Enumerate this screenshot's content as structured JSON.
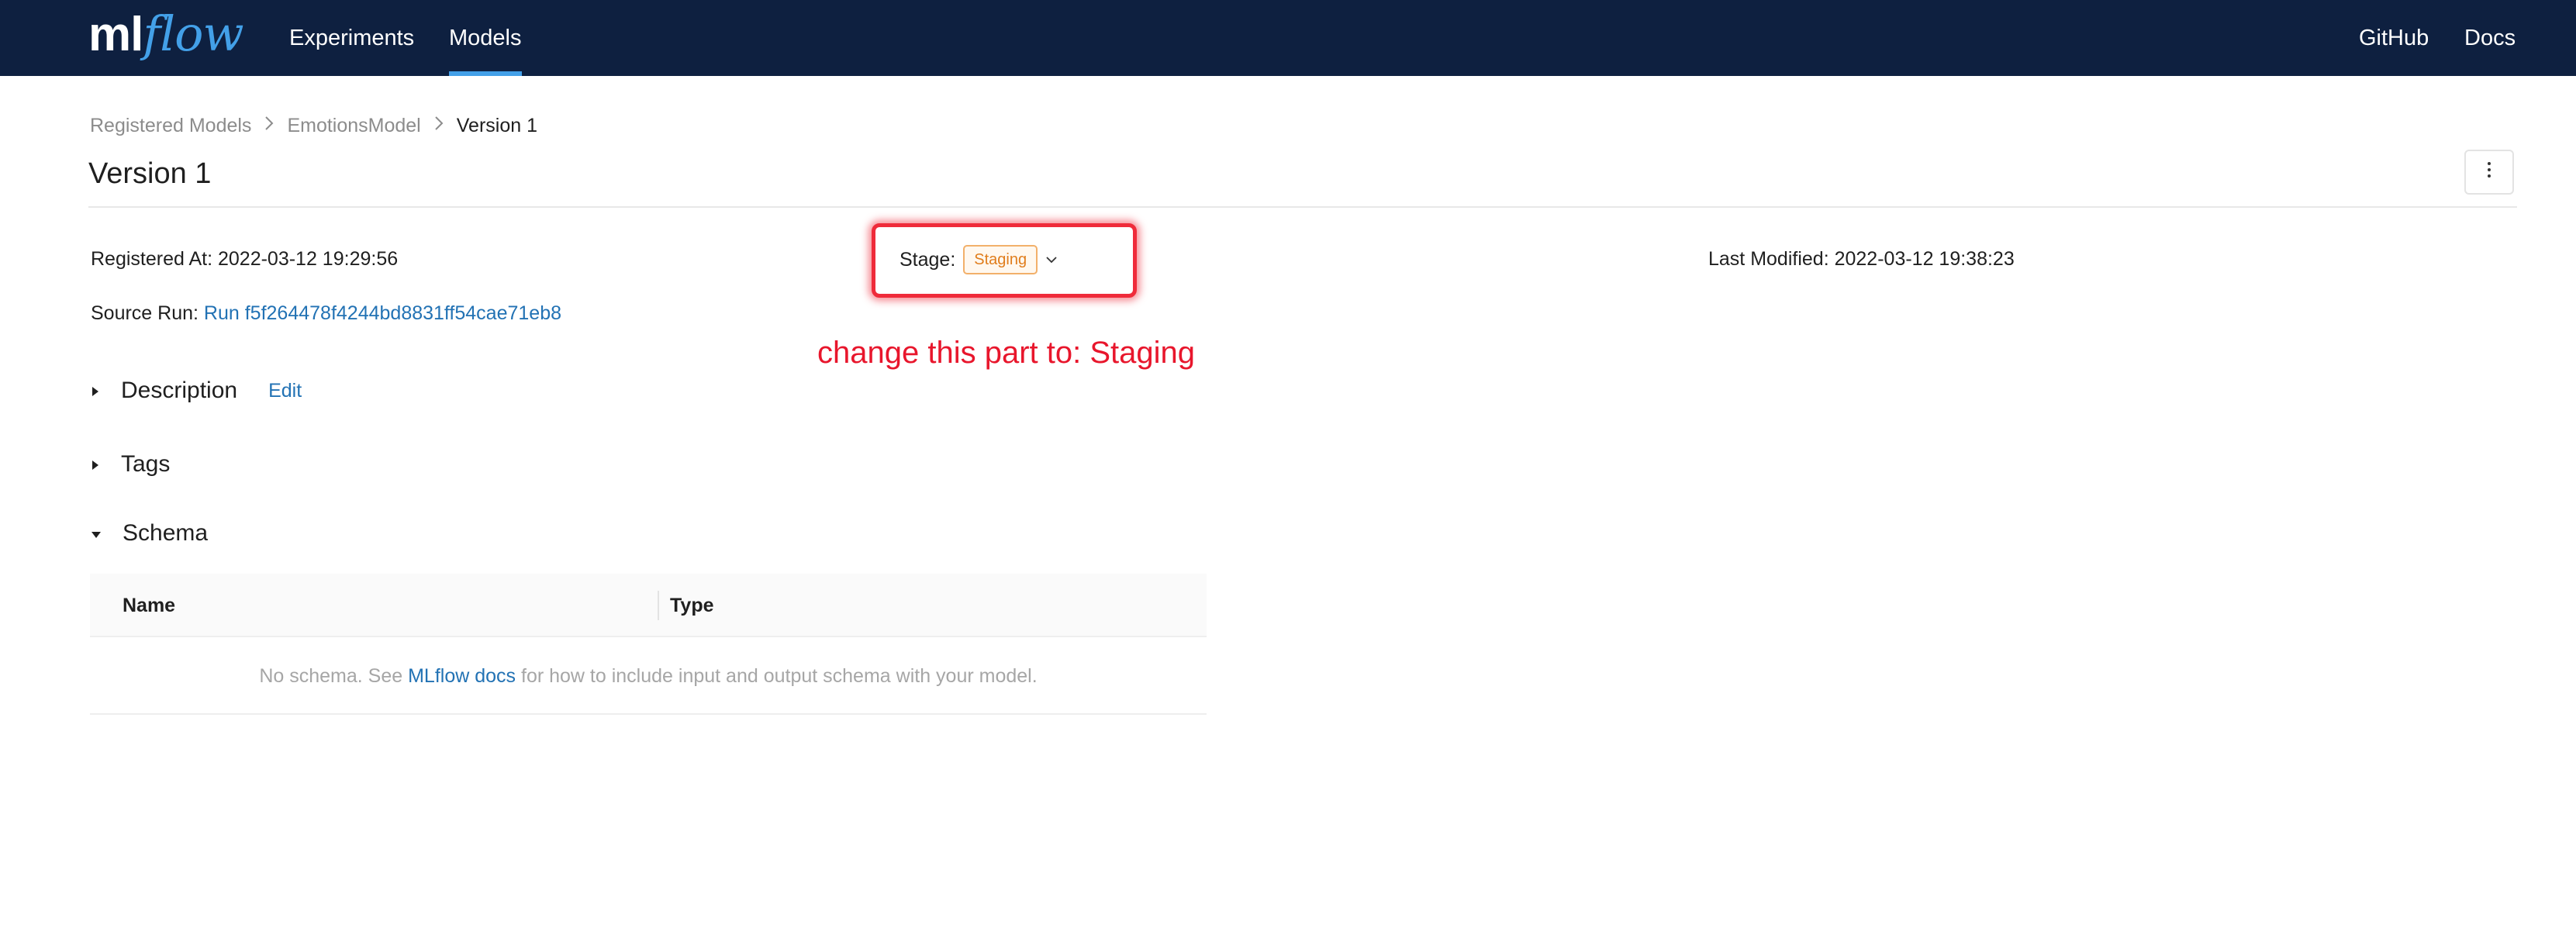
{
  "nav": {
    "logo_ml": "ml",
    "logo_flow": "flow",
    "experiments": "Experiments",
    "models": "Models",
    "github": "GitHub",
    "docs": "Docs",
    "active_color": "#43a0e8",
    "bg_color": "#0e2040"
  },
  "breadcrumb": {
    "items": [
      "Registered Models",
      "EmotionsModel",
      "Version 1"
    ]
  },
  "page": {
    "title": "Version 1",
    "more_icon": "more-vertical-icon"
  },
  "meta": {
    "registered_at_label": "Registered At:",
    "registered_at_value": "2022-03-12 19:29:56",
    "stage_label": "Stage:",
    "stage_value": "Staging",
    "last_modified_label": "Last Modified:",
    "last_modified_value": "2022-03-12 19:38:23",
    "source_run_label": "Source Run:",
    "source_run_value": "Run f5f264478f4244bd8831ff54cae71eb8"
  },
  "annotation": {
    "text": "change this part to: Staging",
    "color": "#e8162c"
  },
  "sections": {
    "description": "Description",
    "description_edit": "Edit",
    "tags": "Tags",
    "schema": "Schema"
  },
  "schema_table": {
    "columns": [
      "Name",
      "Type"
    ],
    "empty_prefix": "No schema. See ",
    "empty_link": "MLflow docs",
    "empty_suffix": " for how to include input and output schema with your model."
  }
}
